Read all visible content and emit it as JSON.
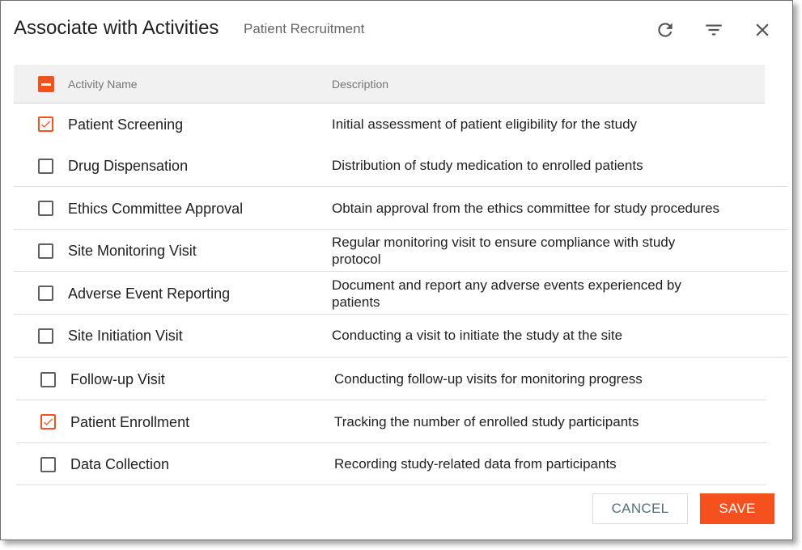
{
  "dialog": {
    "title": "Associate with Activities",
    "subtitle": "Patient Recruitment"
  },
  "toolbar": {
    "refresh_icon": "refresh-icon",
    "filter_icon": "filter-icon",
    "close_icon": "close-icon"
  },
  "table": {
    "headers": {
      "name": "Activity Name",
      "description": "Description"
    },
    "select_all_state": "indeterminate",
    "rows": [
      {
        "name": "Patient Screening",
        "description": "Initial assessment of patient eligibility for the study",
        "checked": true
      },
      {
        "name": "Drug Dispensation",
        "description": "Distribution of study medication to enrolled patients",
        "checked": false
      },
      {
        "name": "Ethics Committee Approval",
        "description": "Obtain approval from the ethics committee for study procedures",
        "checked": false
      },
      {
        "name": "Site Monitoring Visit",
        "description": "Regular monitoring visit to ensure compliance with study protocol",
        "checked": false
      },
      {
        "name": "Adverse Event Reporting",
        "description": "Document and report any adverse events experienced by patients",
        "checked": false
      },
      {
        "name": "Site Initiation Visit",
        "description": "Conducting a visit to initiate the study at the site",
        "checked": false
      },
      {
        "name": "Follow-up Visit",
        "description": "Conducting follow-up visits for monitoring progress",
        "checked": false
      },
      {
        "name": "Patient Enrollment",
        "description": "Tracking the number of enrolled study participants",
        "checked": true
      },
      {
        "name": "Data Collection",
        "description": "Recording study-related data from participants",
        "checked": false
      }
    ]
  },
  "footer": {
    "cancel_label": "CANCEL",
    "save_label": "SAVE"
  },
  "colors": {
    "accent": "#f4511e",
    "header_bg": "#f1f1f1"
  }
}
